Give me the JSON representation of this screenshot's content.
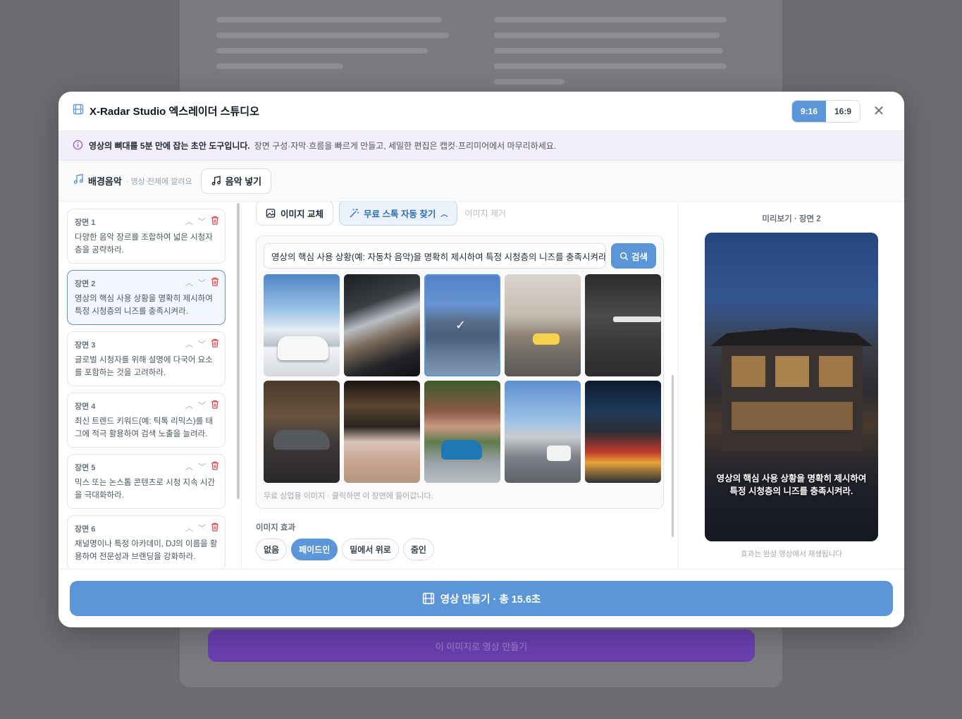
{
  "header": {
    "title": "X-Radar Studio 엑스레이더 스튜디오",
    "ratio_options": [
      "9:16",
      "16:9"
    ],
    "close": "✕"
  },
  "notice": {
    "strong": "영상의 뼈대를 5분 만에 잡는 초안 도구입니다.",
    "text": "장면 구성·자막·흐름을 빠르게 만들고, 세밀한 편집은 캡컷·프리미어에서 마무리하세요."
  },
  "music": {
    "label": "배경음악",
    "sub": "· 영상 전체에 깔려요",
    "button": "음악 넣기"
  },
  "scenes": [
    {
      "name": "장면 1",
      "text": "다양한 음악 장르를 조합하여 넓은 시청자층을 공략하라."
    },
    {
      "name": "장면 2",
      "text": "영상의 핵심 사용 상황을 명확히 제시하여 특정 시청층의 니즈를 충족시켜라."
    },
    {
      "name": "장면 3",
      "text": "글로벌 시청자를 위해 설명에 다국어 요소를 포함하는 것을 고려하라."
    },
    {
      "name": "장면 4",
      "text": "최신 트렌드 키워드(예: 틱톡 리믹스)를 태그에 적극 활용하여 검색 노출을 늘려라."
    },
    {
      "name": "장면 5",
      "text": "믹스 또는 논스톱 콘텐츠로 시청 지속 시간을 극대화하라."
    },
    {
      "name": "장면 6",
      "text": "채널명이나 특정 아카데미, DJ의 이름을 활용하여 전문성과 브랜딩을 강화하라."
    }
  ],
  "toolbar": {
    "replace": "이미지 교체",
    "stock": "무료 스톡 자동 찾기",
    "remove": "이미지 제거"
  },
  "stock": {
    "query": "영상의 핵심 사용 상황(예: 자동차 음악)을 명확히 제시하여 특정 시청층의 니즈를 충족시켜라.",
    "search": "검색",
    "foot": "무료 상업용 이미지 · 클릭하면 이 장면에 들어갑니다."
  },
  "effects": {
    "label": "이미지 효과",
    "options": [
      "없음",
      "페이드인",
      "밑에서 위로",
      "줌인"
    ],
    "selected": "페이드인"
  },
  "preview": {
    "title": "미리보기 · 장면 2",
    "caption_line1": "영상의 핵심 사용 상황을 명확히 제시하여",
    "caption_line2": "특정 시청층의 니즈를 충족시켜라.",
    "note": "효과는 완성 영상에서 재생됩니다"
  },
  "footer": {
    "make": "영상 만들기 · 총 15.6초"
  },
  "background": {
    "button": "이 이미지로 영상 만들기"
  },
  "colors": {
    "accent": "#5b96d8",
    "danger": "#e0464b",
    "notice_bg": "#f3effa"
  }
}
